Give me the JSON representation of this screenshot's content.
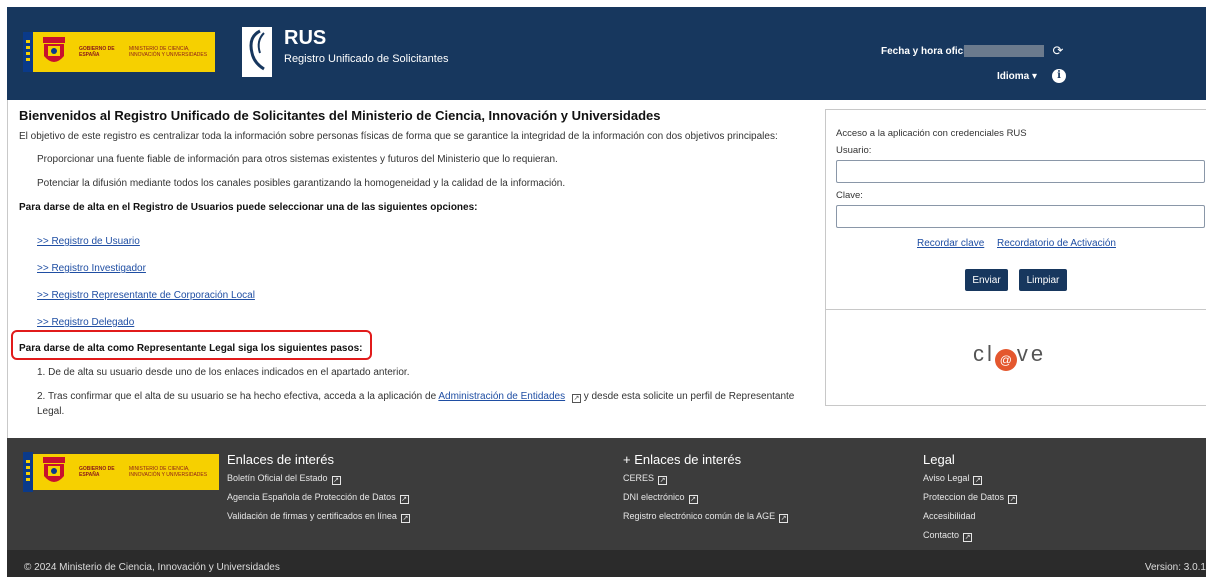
{
  "header": {
    "gov_text": "GOBIERNO DE ESPAÑA",
    "ministry_text": "MINISTERIO DE CIENCIA, INNOVACIÓN Y UNIVERSIDADES",
    "app_title": "RUS",
    "app_subtitle": "Registro Unificado de Solicitantes",
    "fecha_label": "Fecha y hora oficial:",
    "idioma_label": "Idioma ▾",
    "refresh_glyph": "⟳",
    "info_glyph": "i"
  },
  "main": {
    "title": "Bienvenidos al Registro Unificado de Solicitantes del Ministerio de Ciencia, Innovación y Universidades",
    "intro": "El objetivo de este registro es centralizar toda la información sobre personas físicas de forma que se garantice la integridad de la información con dos objetivos principales:",
    "objective_1": "Proporcionar una fuente fiable de información para otros sistemas existentes y futuros del Ministerio que lo requieran.",
    "objective_2": "Potenciar la difusión mediante todos los canales posibles garantizando la homogeneidad y la calidad de la información.",
    "options_heading": "Para darse de alta en el Registro de Usuarios puede seleccionar una de las siguientes opciones:",
    "links": [
      ">> Registro de Usuario",
      ">> Registro Investigador",
      ">> Registro Representante de Corporación Local",
      ">> Registro Delegado"
    ],
    "legal_heading": "Para darse de alta como Representante Legal siga los siguientes pasos:",
    "step_1": "1. De de alta su usuario desde uno de los enlaces indicados en el apartado anterior.",
    "step_2_pre": "2. Tras confirmar que el alta de su usuario se ha hecho efectiva, acceda a la aplicación de",
    "step_2_link": "Administración de Entidades",
    "step_2_post": "y desde esta solicite un perfil de Representante Legal."
  },
  "login": {
    "heading": "Acceso a la aplicación con credenciales RUS",
    "user_label": "Usuario:",
    "user_value": "",
    "password_label": "Clave:",
    "password_value": "",
    "remember_link": "Recordar clave",
    "activation_link": "Recordatorio de Activación",
    "send_button": "Enviar",
    "clear_button": "Limpiar",
    "clave_left": "cl",
    "clave_o": "@",
    "clave_right": "ve"
  },
  "footer": {
    "col1_title": "Enlaces de interés",
    "col1_items": [
      "Boletín Oficial del Estado",
      "Agencia Española de Protección de Datos",
      "Validación de firmas y certificados en línea"
    ],
    "col2_title": "+ Enlaces de interés",
    "col2_items": [
      "CERES",
      "DNI electrónico",
      "Registro electrónico común de la AGE"
    ],
    "col3_title": "Legal",
    "col3_items": [
      "Aviso Legal",
      "Proteccion de Datos",
      "Accesibilidad",
      "Contacto"
    ],
    "ext_glyph": "↗",
    "copyright": "© 2024 Ministerio de Ciencia, Innovación y Universidades",
    "version": "Version: 3.0.1"
  },
  "colors": {
    "header_bg": "#17375e",
    "footer_bg": "#3c3c3c",
    "link": "#1f4ea3",
    "highlight": "#e11b1b",
    "gov_yellow": "#f6d000"
  }
}
